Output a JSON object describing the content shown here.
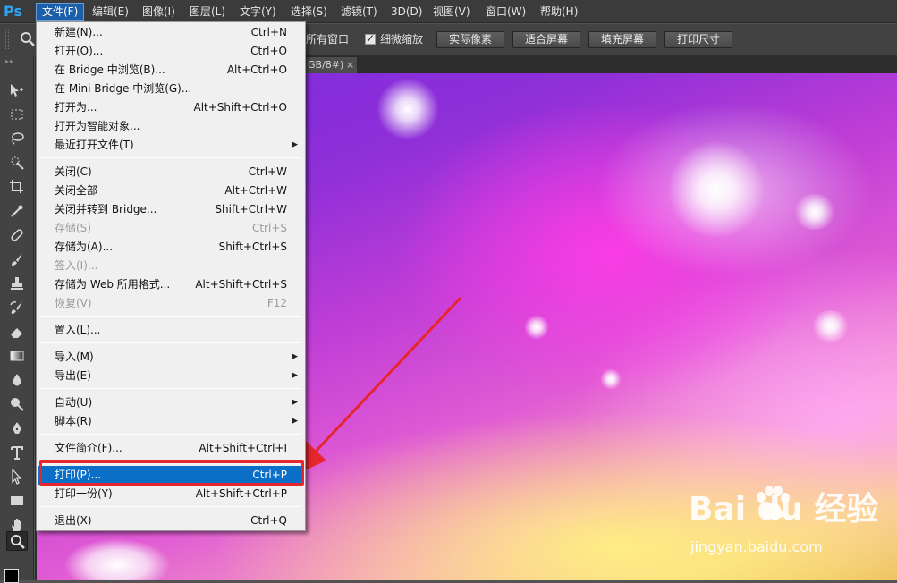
{
  "app": {
    "logo": "Ps"
  },
  "menubar": {
    "items": [
      {
        "label": "文件(F)",
        "active": true
      },
      {
        "label": "编辑(E)"
      },
      {
        "label": "图像(I)"
      },
      {
        "label": "图层(L)"
      },
      {
        "label": "文字(Y)"
      },
      {
        "label": "选择(S)"
      },
      {
        "label": "滤镜(T)"
      },
      {
        "label": "3D(D)"
      },
      {
        "label": "视图(V)"
      },
      {
        "label": "窗口(W)"
      },
      {
        "label": "帮助(H)"
      }
    ]
  },
  "options": {
    "partial_label": "所有窗口",
    "scrubby_zoom_label": "细微缩放",
    "scrubby_zoom_checked": true,
    "buttons": [
      "实际像素",
      "适合屏幕",
      "填充屏幕",
      "打印尺寸"
    ]
  },
  "document": {
    "tab_label": "GB/8#)",
    "close_glyph": "×"
  },
  "file_menu": {
    "items": [
      {
        "label": "新建(N)...",
        "shortcut": "Ctrl+N"
      },
      {
        "label": "打开(O)...",
        "shortcut": "Ctrl+O"
      },
      {
        "label": "在 Bridge 中浏览(B)...",
        "shortcut": "Alt+Ctrl+O"
      },
      {
        "label": "在 Mini Bridge 中浏览(G)...",
        "shortcut": ""
      },
      {
        "label": "打开为...",
        "shortcut": "Alt+Shift+Ctrl+O"
      },
      {
        "label": "打开为智能对象...",
        "shortcut": ""
      },
      {
        "label": "最近打开文件(T)",
        "shortcut": "",
        "submenu": true
      },
      {
        "label": "关闭(C)",
        "shortcut": "Ctrl+W"
      },
      {
        "label": "关闭全部",
        "shortcut": "Alt+Ctrl+W"
      },
      {
        "label": "关闭并转到 Bridge...",
        "shortcut": "Shift+Ctrl+W"
      },
      {
        "label": "存储(S)",
        "shortcut": "Ctrl+S",
        "disabled": true
      },
      {
        "label": "存储为(A)...",
        "shortcut": "Shift+Ctrl+S"
      },
      {
        "label": "签入(I)...",
        "shortcut": "",
        "disabled": true
      },
      {
        "label": "存储为 Web 所用格式...",
        "shortcut": "Alt+Shift+Ctrl+S"
      },
      {
        "label": "恢复(V)",
        "shortcut": "F12",
        "disabled": true
      },
      {
        "label": "置入(L)...",
        "shortcut": ""
      },
      {
        "label": "导入(M)",
        "shortcut": "",
        "submenu": true
      },
      {
        "label": "导出(E)",
        "shortcut": "",
        "submenu": true
      },
      {
        "label": "自动(U)",
        "shortcut": "",
        "submenu": true
      },
      {
        "label": "脚本(R)",
        "shortcut": "",
        "submenu": true
      },
      {
        "label": "文件简介(F)...",
        "shortcut": "Alt+Shift+Ctrl+I"
      },
      {
        "label": "打印(P)...",
        "shortcut": "Ctrl+P",
        "highlighted": true
      },
      {
        "label": "打印一份(Y)",
        "shortcut": "Alt+Shift+Ctrl+P"
      },
      {
        "label": "退出(X)",
        "shortcut": "Ctrl+Q"
      }
    ]
  },
  "watermark": {
    "brand": "Bai  du 经验",
    "url": "jingyan.baidu.com"
  },
  "colors": {
    "accent": "#0b6fc7",
    "annotation": "#e5262f",
    "ps_blue": "#2fa3f0"
  }
}
